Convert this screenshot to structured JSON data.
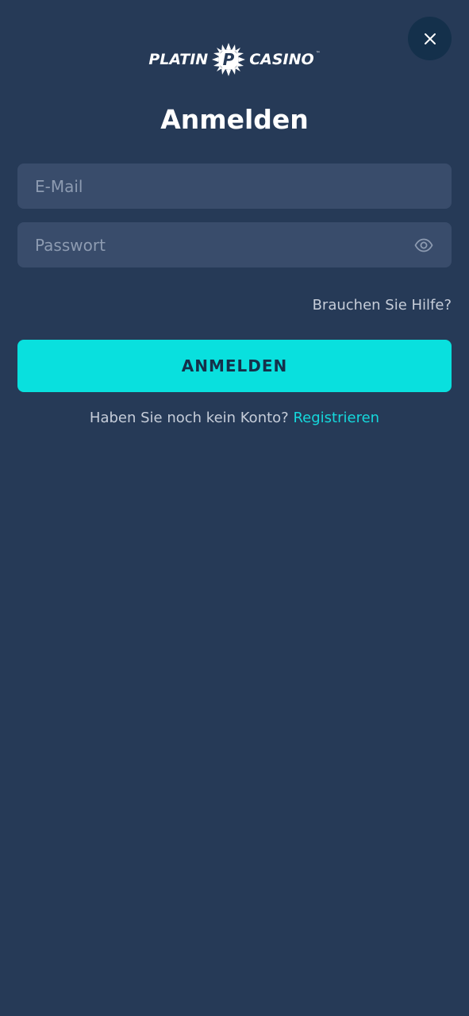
{
  "logo": {
    "left_word": "PLATIN",
    "right_word": "CASINO",
    "trademark": "™",
    "icon": "platin-sun-logo-icon"
  },
  "close": {
    "icon": "close-icon"
  },
  "title": "Anmelden",
  "form": {
    "email_placeholder": "E-Mail",
    "email_value": "",
    "password_placeholder": "Passwort",
    "password_value": "",
    "password_toggle_icon": "eye-icon"
  },
  "help_link": "Brauchen Sie Hilfe?",
  "submit_label": "ANMELDEN",
  "register": {
    "prompt": "Haben Sie noch kein Konto?",
    "link": "Registrieren"
  },
  "colors": {
    "background": "#263a57",
    "input_background": "#394c6b",
    "accent": "#09e0de",
    "link": "#15d8dc",
    "close_button": "#14304b"
  }
}
